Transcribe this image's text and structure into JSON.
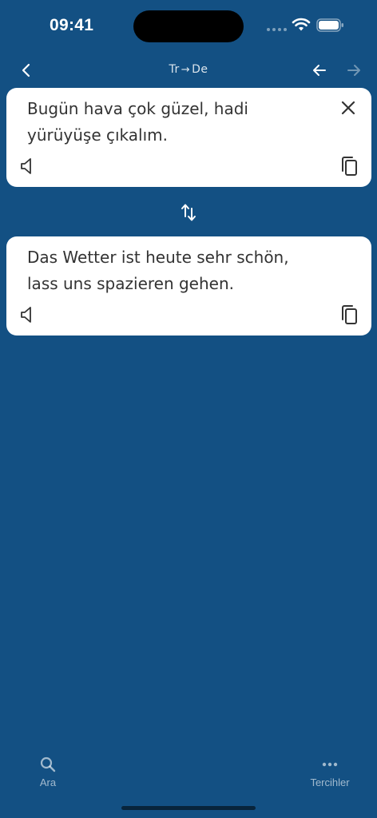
{
  "status_bar": {
    "time": "09:41"
  },
  "nav": {
    "source_lang": "Tr",
    "arrow": "→",
    "target_lang": "De"
  },
  "source_card": {
    "text": "Bugün hava çok güzel, hadi yürüyüşe çıkalım."
  },
  "target_card": {
    "text": "Das Wetter ist heute sehr schön, lass uns spazieren gehen."
  },
  "tab_bar": {
    "search_label": "Ara",
    "preferences_label": "Tercihler"
  },
  "colors": {
    "background": "#135083",
    "card": "#ffffff",
    "text": "#333333"
  },
  "icons": {
    "back": "chevron-left-icon",
    "prev": "arrow-left-icon",
    "next": "arrow-right-icon",
    "clear": "close-icon",
    "speaker": "speaker-icon",
    "copy": "copy-icon",
    "swap": "swap-vertical-icon",
    "search": "search-icon",
    "more": "more-horizontal-icon"
  }
}
